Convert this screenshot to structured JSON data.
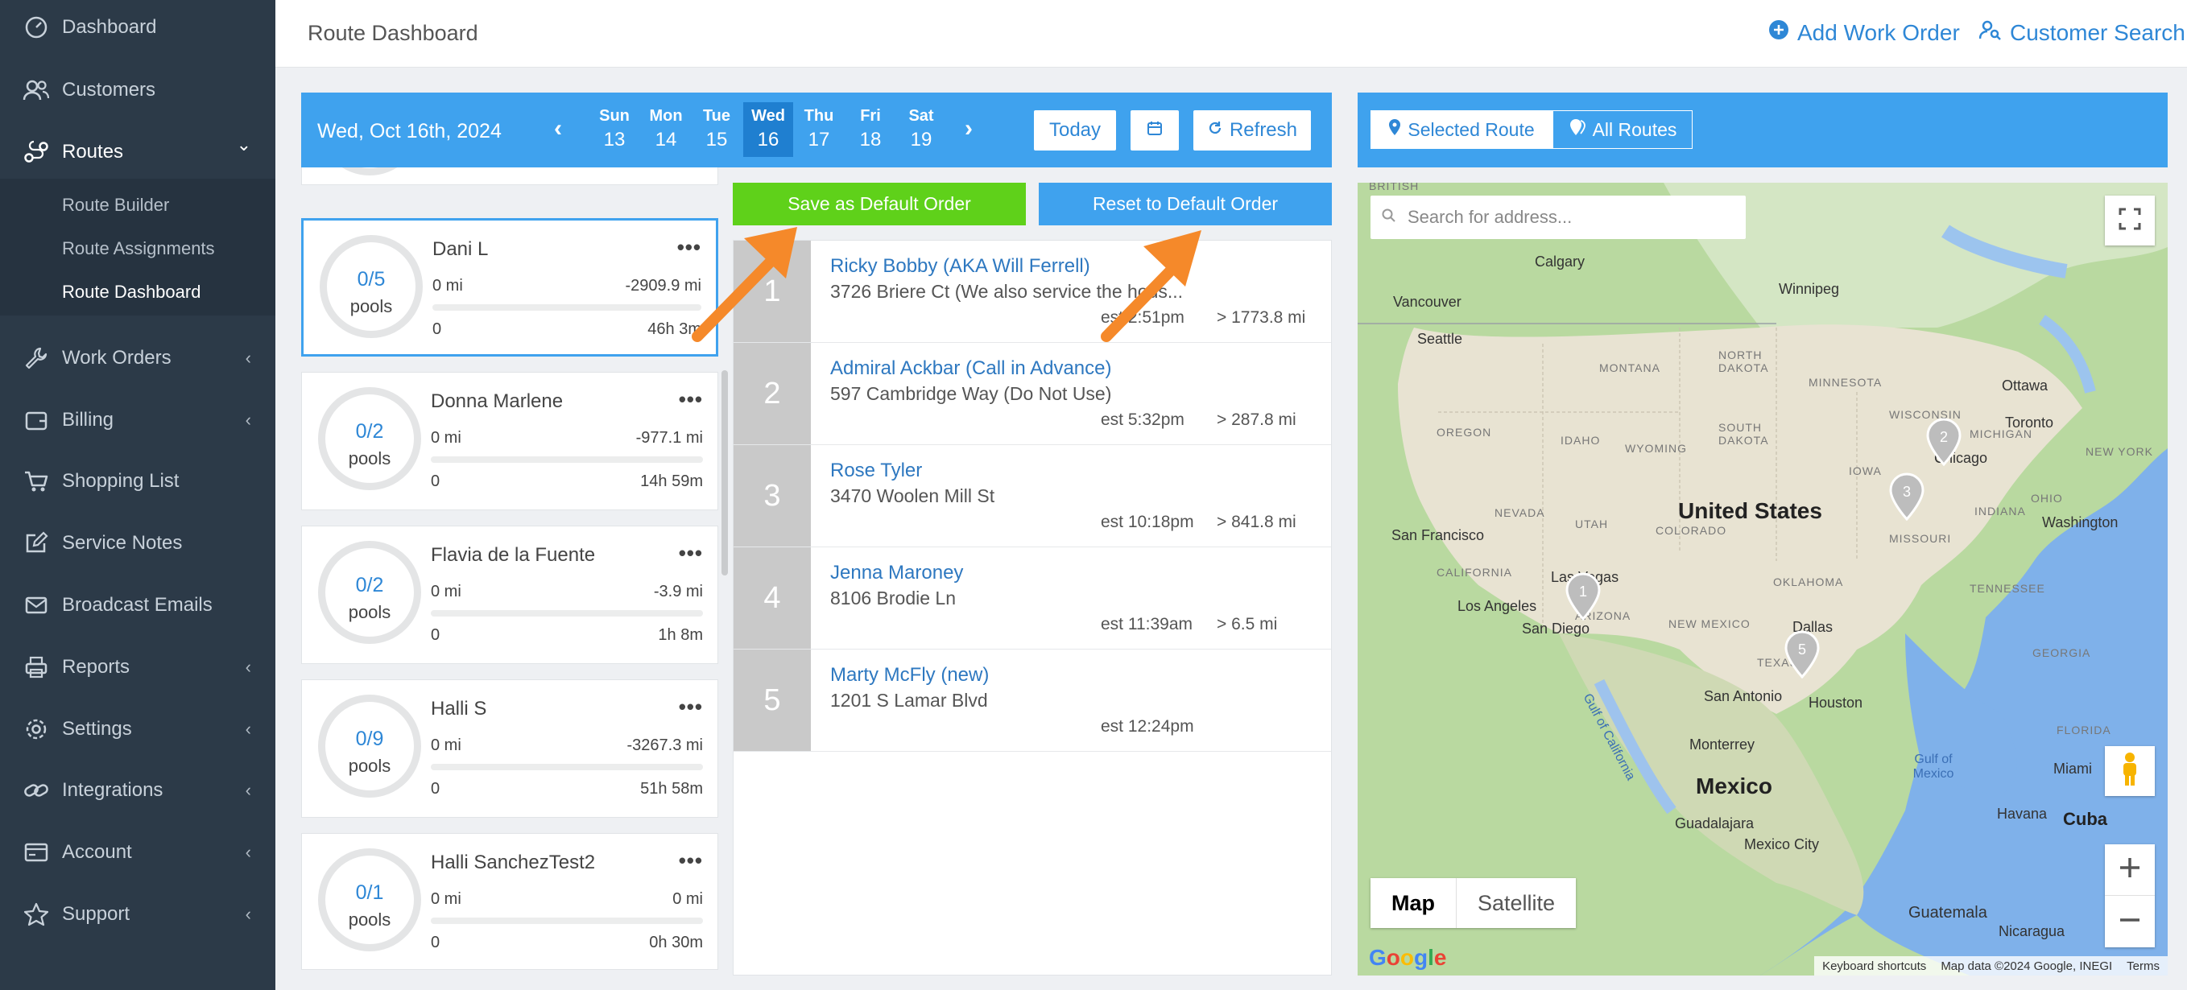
{
  "sidebar": {
    "items": [
      {
        "label": "Dashboard",
        "icon": "dashboard-icon",
        "chevron": ""
      },
      {
        "label": "Customers",
        "icon": "users-icon",
        "chevron": ""
      },
      {
        "label": "Routes",
        "icon": "route-icon",
        "chevron": "⌄"
      },
      {
        "label": "Work Orders",
        "icon": "wrench-icon",
        "chevron": "‹"
      },
      {
        "label": "Billing",
        "icon": "wallet-icon",
        "chevron": "‹"
      },
      {
        "label": "Shopping List",
        "icon": "cart-icon",
        "chevron": ""
      },
      {
        "label": "Service Notes",
        "icon": "edit-icon",
        "chevron": ""
      },
      {
        "label": "Broadcast Emails",
        "icon": "envelope-icon",
        "chevron": ""
      },
      {
        "label": "Reports",
        "icon": "printer-icon",
        "chevron": "‹"
      },
      {
        "label": "Settings",
        "icon": "gear-icon",
        "chevron": "‹"
      },
      {
        "label": "Integrations",
        "icon": "link-icon",
        "chevron": "‹"
      },
      {
        "label": "Account",
        "icon": "card-icon",
        "chevron": "‹"
      },
      {
        "label": "Support",
        "icon": "star-icon",
        "chevron": "‹"
      }
    ],
    "routes_sub": [
      "Route Builder",
      "Route Assignments",
      "Route Dashboard"
    ]
  },
  "header": {
    "title": "Route Dashboard",
    "add_work_order": "Add Work Order",
    "customer_search": "Customer Search"
  },
  "calendar": {
    "current_date": "Wed, Oct 16th, 2024",
    "prev": "‹",
    "next": "›",
    "days": [
      {
        "name": "Sun",
        "date": "13"
      },
      {
        "name": "Mon",
        "date": "14"
      },
      {
        "name": "Tue",
        "date": "15"
      },
      {
        "name": "Wed",
        "date": "16"
      },
      {
        "name": "Thu",
        "date": "17"
      },
      {
        "name": "Fri",
        "date": "18"
      },
      {
        "name": "Sat",
        "date": "19"
      }
    ],
    "selected_day": "Wed",
    "today_label": "Today",
    "refresh_label": "Refresh"
  },
  "map_tabs": {
    "selected_route": "Selected Route",
    "all_routes": "All Routes"
  },
  "actions": {
    "save_default": "Save as Default Order",
    "reset_default": "Reset to Default Order"
  },
  "routes": [
    {
      "name": "Dani L",
      "count": "0/5",
      "unit": "pools",
      "miles": "0 mi",
      "delta": "-2909.9 mi",
      "done": "0",
      "time": "46h 3m"
    },
    {
      "name": "Donna Marlene",
      "count": "0/2",
      "unit": "pools",
      "miles": "0 mi",
      "delta": "-977.1 mi",
      "done": "0",
      "time": "14h 59m"
    },
    {
      "name": "Flavia de la Fuente",
      "count": "0/2",
      "unit": "pools",
      "miles": "0 mi",
      "delta": "-3.9 mi",
      "done": "0",
      "time": "1h 8m"
    },
    {
      "name": "Halli S",
      "count": "0/9",
      "unit": "pools",
      "miles": "0 mi",
      "delta": "-3267.3 mi",
      "done": "0",
      "time": "51h 58m"
    },
    {
      "name": "Halli SanchezTest2",
      "count": "0/1",
      "unit": "pools",
      "miles": "0 mi",
      "delta": "0 mi",
      "done": "0",
      "time": "0h 30m"
    }
  ],
  "stops": [
    {
      "num": "1",
      "name": "Ricky Bobby (AKA Will Ferrell)",
      "address": "3726 Briere Ct (We also service the hous...",
      "est": "est 2:51pm",
      "dist": "> 1773.8 mi"
    },
    {
      "num": "2",
      "name": "Admiral Ackbar (Call in Advance)",
      "address": "597 Cambridge Way (Do Not Use)",
      "est": "est 5:32pm",
      "dist": "> 287.8 mi"
    },
    {
      "num": "3",
      "name": "Rose Tyler",
      "address": "3470 Woolen Mill St",
      "est": "est 10:18pm",
      "dist": "> 841.8 mi"
    },
    {
      "num": "4",
      "name": "Jenna Maroney",
      "address": "8106 Brodie Ln",
      "est": "est 11:39am",
      "dist": "> 6.5 mi"
    },
    {
      "num": "5",
      "name": "Marty McFly (new)",
      "address": "1201 S Lamar Blvd",
      "est": "est 12:24pm",
      "dist": ""
    }
  ],
  "map": {
    "search_placeholder": "Search for address...",
    "map_label": "Map",
    "satellite_label": "Satellite",
    "google": "Google",
    "keyboard": "Keyboard shortcuts",
    "map_data": "Map data ©2024 Google, INEGI",
    "terms": "Terms",
    "labels": {
      "british": "BRITISH",
      "calgary": "Calgary",
      "winnipeg": "Winnipeg",
      "vancouver": "Vancouver",
      "seattle": "Seattle",
      "north_dakota": "NORTH DAKOTA",
      "montana": "MONTANA",
      "minnesota": "MINNESOTA",
      "ottawa": "Ottawa",
      "oregon": "OREGON",
      "idaho": "IDAHO",
      "wyoming": "WYOMING",
      "south_dakota": "SOUTH DAKOTA",
      "wisconsin": "WISCONSIN",
      "michigan": "MICHIGAN",
      "toronto": "Toronto",
      "new_york": "NEW YORK",
      "iowa": "IOWA",
      "chicago": "Chicago",
      "nevada": "NEVADA",
      "utah": "UTAH",
      "colorado": "COLORADO",
      "united_states": "United States",
      "missouri": "MISSOURI",
      "indiana": "INDIANA",
      "ohio": "OHIO",
      "washington": "Washington",
      "san_francisco": "San Francisco",
      "california": "CALIFORNIA",
      "las_vegas": "Las Vegas",
      "oklahoma": "OKLAHOMA",
      "tennessee": "TENNESSEE",
      "los_angeles": "Los Angeles",
      "arizona": "ARIZONA",
      "new_mexico": "NEW MEXICO",
      "san_diego": "San Diego",
      "dallas": "Dallas",
      "texas": "TEXAS",
      "georgia": "GEORGIA",
      "san_antonio": "San Antonio",
      "houston": "Houston",
      "gulf_of_california": "Gulf of California",
      "florida": "FLORIDA",
      "gulf_of_mexico": "Gulf of Mexico",
      "miami": "Miami",
      "monterrey": "Monterrey",
      "mexico": "Mexico",
      "havana": "Havana",
      "cuba": "Cuba",
      "guadalajara": "Guadalajara",
      "mexico_city": "Mexico City",
      "guatemala": "Guatemala",
      "nicaragua": "Nicaragua"
    },
    "pins": [
      "2",
      "3",
      "1",
      "5"
    ]
  },
  "colors": {
    "sidebar_bg": "#2c3a48",
    "accent": "#3fa2ee",
    "link": "#2e87d6",
    "save_green": "#5fd11a",
    "reset_blue": "#3fa2ee",
    "arrow_orange": "#f5892a"
  }
}
